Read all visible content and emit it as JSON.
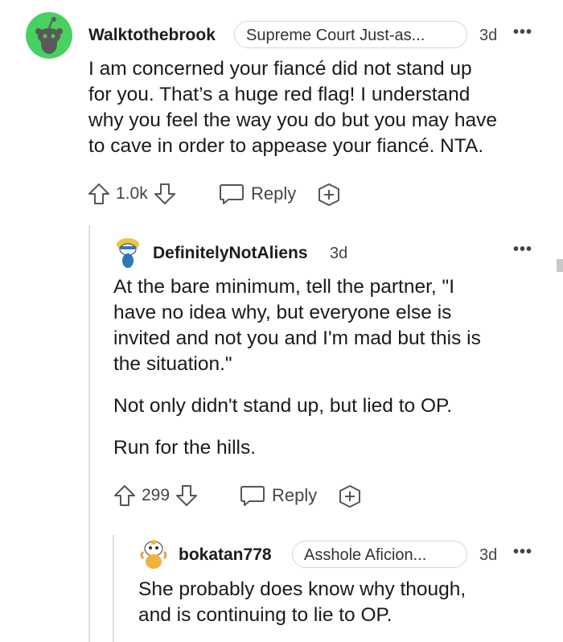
{
  "comments": [
    {
      "username": "Walktothebrook",
      "flair": "Supreme Court Just-as...",
      "age": "3d",
      "body_lines": [
        "I am concerned your fiancé did not stand up",
        "for you. That’s a huge red flag! I understand",
        "why you feel the way you do but you may have",
        "to cave in order to appease your fiancé. NTA."
      ],
      "score": "1.0k",
      "reply_label": "Reply",
      "avatar_color": "#46d160"
    },
    {
      "username": "DefinitelyNotAliens",
      "age": "3d",
      "paragraphs": [
        [
          "At the bare minimum, tell the partner, \"I",
          "have no idea why, but everyone else is",
          "invited and not you and I'm mad but this is",
          "the situation.\""
        ],
        [
          "Not only didn't stand up, but lied to OP."
        ],
        [
          "Run for the hills."
        ]
      ],
      "score": "299",
      "reply_label": "Reply"
    },
    {
      "username": "bokatan778",
      "flair": "Asshole Aficion...",
      "age": "3d",
      "body_lines": [
        "She probably does know why though,",
        "and is continuing to lie to OP."
      ]
    }
  ],
  "icons": {
    "more": "more-options-icon",
    "upvote": "upvote-arrow-icon",
    "downvote": "downvote-arrow-icon",
    "reply": "speech-bubble-icon",
    "award": "award-plus-icon"
  },
  "colors": {
    "text": "#1a1a1b",
    "muted": "#444444",
    "thread_line": "#e0e0e0",
    "flair_border": "#d6d6d6"
  }
}
